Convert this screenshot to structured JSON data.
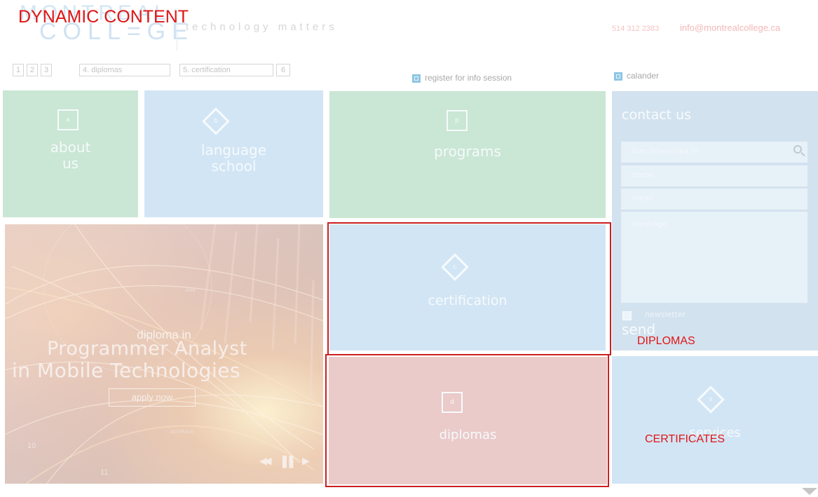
{
  "annotations": {
    "title": "DYNAMIC CONTENT",
    "diplomas_label": "DIPLOMAS",
    "certificates_label": "CERTIFICATES"
  },
  "header": {
    "logo_top": "MONTREAL",
    "logo_bottom": "COLL=GE",
    "tagline": "technology matters",
    "phone": "514 312 2383",
    "email": "info@montrealcollege.ca",
    "nav": [
      "1",
      "2",
      "3",
      "4. diplomas",
      "5. certification",
      "6"
    ],
    "register_link": "register for info session",
    "calendar_link": "calander"
  },
  "tiles": {
    "about": {
      "badge": "a",
      "label_line1": "about",
      "label_line2": "us"
    },
    "language": {
      "badge": "b",
      "label_line1": "language",
      "label_line2": "school"
    },
    "programs": {
      "badge": "p",
      "label": "programs"
    },
    "certification": {
      "badge": "c",
      "label": "certification"
    },
    "diplomas": {
      "badge": "d",
      "label": "diplomas"
    },
    "services": {
      "badge": "s",
      "label": "services"
    }
  },
  "contact": {
    "title": "contact us",
    "interest_placeholder": "Iam interested in",
    "name_placeholder": "name",
    "email_placeholder": "email",
    "message_placeholder": "message",
    "newsletter_label": "newsletter",
    "send_label": "send"
  },
  "hero": {
    "small": "diploma in",
    "line1": "Programmer Analyst",
    "line2": "in Mobile Technologies",
    "apply_label": "apply now",
    "controls": {
      "prev": "◀◀",
      "pause": "▌▌",
      "next": "▶"
    },
    "map_labels": {
      "asia": "ASIA",
      "australia": "AUSTRALIA"
    },
    "numbers": {
      "n10": "10",
      "n11": "11"
    }
  },
  "colors": {
    "green_tile": "#cae6d4",
    "blue_tile": "#d2e5f5",
    "contact_panel": "#d3e2ef",
    "pink_tile": "#ebcaca",
    "annotation_red": "#e01515"
  }
}
